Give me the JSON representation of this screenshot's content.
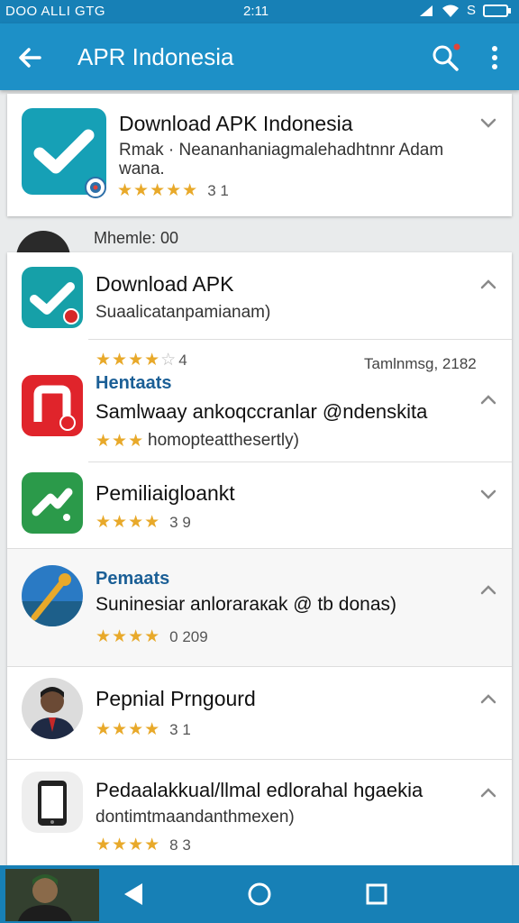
{
  "status_bar": {
    "left_text": "DOO ALLI GTG",
    "time": "2:11",
    "right_text": "S"
  },
  "app_bar": {
    "title": "APR Indonesia"
  },
  "top_card": {
    "name": "Download APK Indonesia",
    "subtitle_line1": "Rmak · Neananhaniagmalehadhtnnr Adam",
    "subtitle_line2": "wana.",
    "rating_stars": 4.5,
    "rating_text": "3 1"
  },
  "peek": {
    "label": "Mhemle: 00"
  },
  "list": {
    "items": [
      {
        "name": "Download APK",
        "subtitle": "Suaalicatanpamianam)",
        "icon": "check-icon",
        "icon_bg": "#16a0a8",
        "badge_color": "#d62828",
        "chevron": "chevron-up-icon"
      },
      {
        "rating_stars": 4,
        "rating_text": "4",
        "date": "Tamlnmsg, 2182",
        "category": "Hentaats",
        "name": "Samlwaay ankoqccranlar @ndenskita",
        "subtitle": "homopteatthesertly)",
        "subtitle_stars": 3,
        "icon": "app-icon",
        "icon_bg": "#e0242b",
        "badge_color": "#e0242b",
        "chevron": "chevron-up-icon"
      },
      {
        "name": "Pemiliaigloankt",
        "rating_stars": 4,
        "rating_text": "3 9",
        "icon": "share-icon",
        "icon_bg": "#2b9a4a",
        "chevron": "chevron-down-icon"
      },
      {
        "category": "Pemaats",
        "name": "Suninesiar anloraraкak @ tb donas)",
        "rating_stars": 4,
        "rating_text": "0 209",
        "icon": "photo-icon",
        "chevron": "chevron-up-icon"
      },
      {
        "name": "Pepnial Prngourd",
        "rating_stars": 4,
        "rating_text": "3 1",
        "icon": "avatar-icon",
        "chevron": "chevron-up-icon"
      },
      {
        "name": "Pedaalakkual/llmal edlorahal hgaekia",
        "subtitle": "dontimtmaandanthmexen)",
        "rating_stars": 4,
        "rating_text": "8 3",
        "icon": "phone-icon",
        "chevron": "chevron-up-icon"
      }
    ]
  },
  "nav_bar": {
    "buttons": [
      "back-icon",
      "home-icon",
      "recents-icon"
    ]
  },
  "colors": {
    "primary": "#1d90c7",
    "status": "#1780b6",
    "star": "#e8a92a",
    "category": "#1b5f96"
  }
}
